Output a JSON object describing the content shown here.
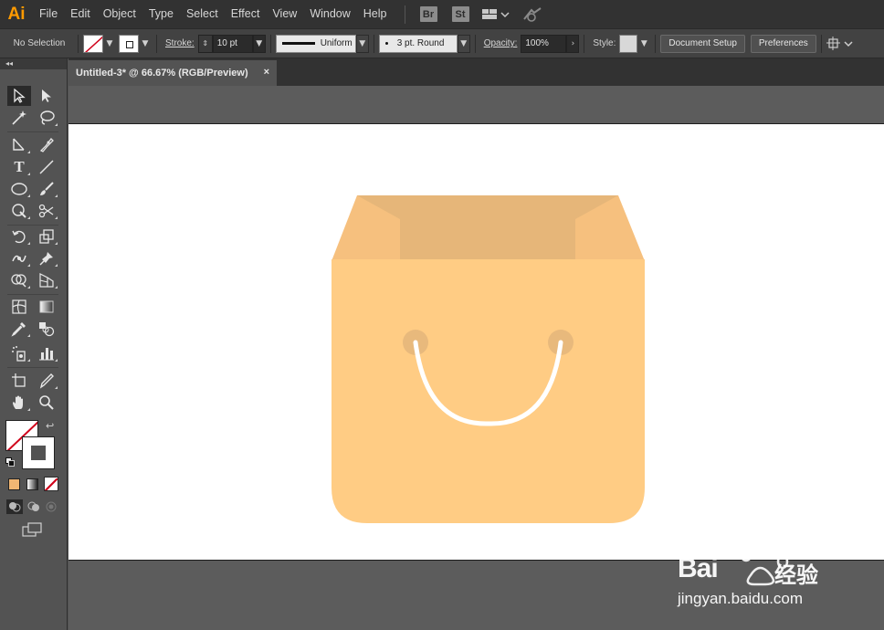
{
  "app": {
    "logo": "Ai",
    "brand_color": "#ff9a00"
  },
  "menu": {
    "items": [
      "File",
      "Edit",
      "Object",
      "Type",
      "Select",
      "Effect",
      "View",
      "Window",
      "Help"
    ],
    "bridge": "Br",
    "stock": "St"
  },
  "control_bar": {
    "selection": "No Selection",
    "stroke_label": "Stroke:",
    "stroke_weight": "10 pt",
    "stroke_profile": "Uniform",
    "brush": "3 pt. Round",
    "opacity_label": "Opacity:",
    "opacity": "100%",
    "style_label": "Style:",
    "document_setup": "Document Setup",
    "preferences": "Preferences"
  },
  "document": {
    "tab_title": "Untitled-3* @ 66.67% (RGB/Preview)",
    "close": "×"
  },
  "artwork": {
    "bag_body_color": "#ffcc84",
    "bag_back_color": "#e6b679",
    "bag_flap_color": "#f6c07e",
    "grommet_color": "#e8b97c",
    "handle_color": "#ffffff"
  },
  "watermark": {
    "brand": "Bai",
    "brand_cn": "经验",
    "url": "jingyan.baidu.com"
  },
  "icons": {
    "selection": "selection-tool-icon",
    "direct_selection": "direct-selection-tool-icon"
  }
}
